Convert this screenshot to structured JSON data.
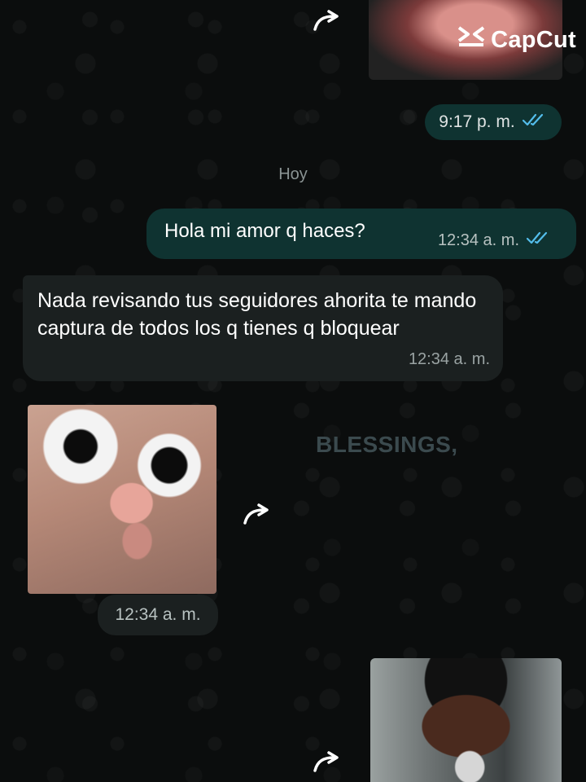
{
  "watermark": {
    "brand": "CapCut"
  },
  "messages": {
    "top_image_time": "9:17 p. m.",
    "day_separator": "Hoy",
    "outgoing_1": {
      "text": "Hola mi amor q haces?",
      "time": "12:34 a. m."
    },
    "incoming_1": {
      "text": "Nada revisando tus seguidores ahorita te mando captura de todos los q  tienes q bloquear",
      "time": "12:34 a. m."
    },
    "incoming_image_time": "12:34 a. m.",
    "image_overlay_text": "BLESSINGS,"
  },
  "colors": {
    "background": "#0b0d0d",
    "outgoing_bubble": "#0f3331",
    "incoming_bubble": "#1b2020",
    "read_ticks": "#53bdeb"
  },
  "icons": {
    "forward": "forward-arrow-icon",
    "read_status": "double-check-icon",
    "brand": "capcut-logo-icon"
  }
}
